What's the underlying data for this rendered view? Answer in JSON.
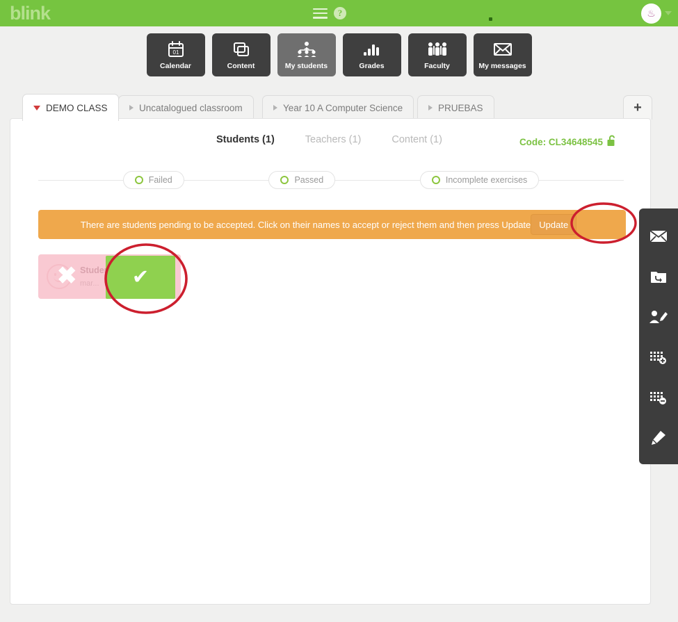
{
  "header": {
    "logo": "blink",
    "menu_icon": "hamburger-icon",
    "help_icon": "help-circle-icon",
    "avatar_glyph": "♨",
    "caret": "chevron-down-icon"
  },
  "nav": {
    "items": [
      {
        "label": "Calendar",
        "icon": "calendar-icon",
        "active": false
      },
      {
        "label": "Content",
        "icon": "layers-icon",
        "active": false
      },
      {
        "label": "My students",
        "icon": "students-group-icon",
        "active": true
      },
      {
        "label": "Grades",
        "icon": "bar-chart-icon",
        "active": false
      },
      {
        "label": "Faculty",
        "icon": "faculty-people-icon",
        "active": false
      },
      {
        "label": "My messages",
        "icon": "envelope-icon",
        "active": false
      }
    ]
  },
  "tabs": {
    "items": [
      {
        "label": "DEMO CLASS",
        "active": true
      },
      {
        "label": "Uncatalogued classroom",
        "active": false
      },
      {
        "label": "Year 10 A Computer Science",
        "active": false
      },
      {
        "label": "PRUEBAS",
        "active": false
      }
    ],
    "add_label": "+"
  },
  "subnav": {
    "items": [
      {
        "label": "Students (1)",
        "active": true
      },
      {
        "label": "Teachers (1)",
        "active": false
      },
      {
        "label": "Content (1)",
        "active": false
      }
    ],
    "code_label": "Code: CL34648545",
    "lock_icon": "unlocked-padlock-icon"
  },
  "filters": {
    "items": [
      {
        "label": "Failed"
      },
      {
        "label": "Passed"
      },
      {
        "label": "Incomplete exercises"
      }
    ]
  },
  "banner": {
    "text": "There are students pending to be accepted. Click on their names to accept or reject them and then press Update",
    "button_label": "Update"
  },
  "student": {
    "name": "Student DEMO",
    "email": "mar...",
    "reject_glyph": "✖",
    "accept_glyph": "✔"
  },
  "tools": {
    "items": [
      {
        "icon": "envelope-icon"
      },
      {
        "icon": "folder-return-icon"
      },
      {
        "icon": "person-edit-icon"
      },
      {
        "icon": "grid-add-icon"
      },
      {
        "icon": "grid-remove-icon"
      },
      {
        "icon": "pencil-icon"
      }
    ]
  },
  "colors": {
    "brand_green": "#76c440",
    "accent_orange": "#efa84c",
    "annotation_red": "#cc1f2e",
    "accept_green": "#8fd14f",
    "reject_pink": "#f9c9d2",
    "nav_dark": "#3f3f3f"
  }
}
